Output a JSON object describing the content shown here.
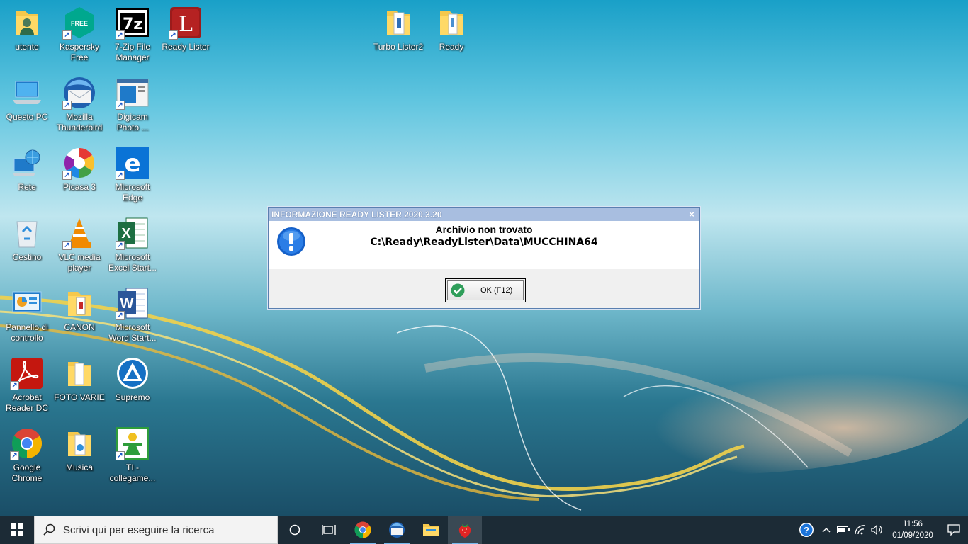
{
  "desktop": {
    "icons": [
      {
        "id": "utente",
        "label": "utente"
      },
      {
        "id": "kaspersky",
        "label": "Kaspersky Free"
      },
      {
        "id": "7zip",
        "label": "7-Zip File Manager"
      },
      {
        "id": "readylister",
        "label": "Ready Lister"
      },
      {
        "id": "turbolister",
        "label": "Turbo Lister2"
      },
      {
        "id": "ready",
        "label": "Ready"
      },
      {
        "id": "questopc",
        "label": "Questo PC"
      },
      {
        "id": "thunderbird",
        "label": "Mozilla Thunderbird"
      },
      {
        "id": "digicam",
        "label": "Digicam Photo ..."
      },
      {
        "id": "rete",
        "label": "Rete"
      },
      {
        "id": "picasa",
        "label": "Picasa 3"
      },
      {
        "id": "edge",
        "label": "Microsoft Edge"
      },
      {
        "id": "cestino",
        "label": "Cestino"
      },
      {
        "id": "vlc",
        "label": "VLC media player"
      },
      {
        "id": "excel",
        "label": "Microsoft Excel Start..."
      },
      {
        "id": "pannello",
        "label": "Pannello di controllo"
      },
      {
        "id": "canon",
        "label": "CANON"
      },
      {
        "id": "word",
        "label": "Microsoft Word Start..."
      },
      {
        "id": "acrobat",
        "label": "Acrobat Reader DC"
      },
      {
        "id": "fotovarie",
        "label": "FOTO VARIE"
      },
      {
        "id": "supremo",
        "label": "Supremo"
      },
      {
        "id": "chrome",
        "label": "Google Chrome"
      },
      {
        "id": "musica",
        "label": "Musica"
      },
      {
        "id": "ti",
        "label": "TI - collegame..."
      }
    ]
  },
  "dialog": {
    "title": "INFORMAZIONE READY LISTER 2020.3.20",
    "close": "×",
    "message_line1": "Archivio non trovato",
    "message_line2": "C:\\Ready\\ReadyLister\\Data\\MUCCHINA64",
    "ok_label": "OK (F12)"
  },
  "taskbar": {
    "search_placeholder": "Scrivi qui per eseguire la ricerca",
    "time": "11:56",
    "date": "01/09/2020"
  }
}
